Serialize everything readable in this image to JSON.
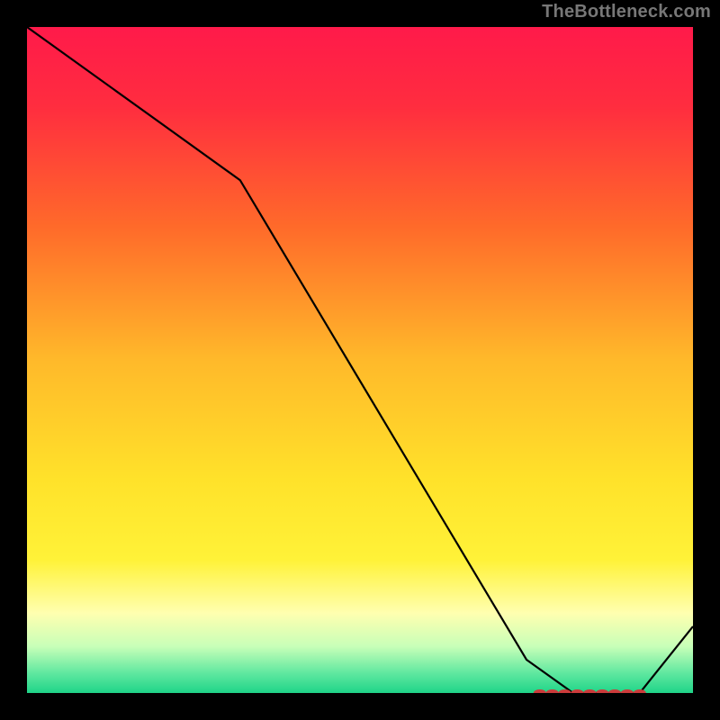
{
  "attribution": "TheBottleneck.com",
  "chart_data": {
    "type": "line",
    "title": "",
    "xlabel": "",
    "ylabel": "",
    "xlim": [
      0,
      100
    ],
    "ylim": [
      0,
      100
    ],
    "x": [
      0,
      32,
      75,
      82,
      84,
      87,
      90,
      92,
      100
    ],
    "values": [
      100,
      77,
      5,
      0,
      0,
      0,
      0,
      0,
      10
    ],
    "flat_region_x": [
      77,
      92
    ],
    "background_gradient": {
      "stops": [
        {
          "offset": 0.0,
          "color": "#ff1a4a"
        },
        {
          "offset": 0.12,
          "color": "#ff2d3f"
        },
        {
          "offset": 0.3,
          "color": "#ff6a2a"
        },
        {
          "offset": 0.5,
          "color": "#ffb92a"
        },
        {
          "offset": 0.68,
          "color": "#ffe22a"
        },
        {
          "offset": 0.8,
          "color": "#fff238"
        },
        {
          "offset": 0.88,
          "color": "#ffffb0"
        },
        {
          "offset": 0.93,
          "color": "#c8ffb8"
        },
        {
          "offset": 0.97,
          "color": "#60e8a0"
        },
        {
          "offset": 1.0,
          "color": "#1fd488"
        }
      ]
    },
    "marker_color": "#cc3b3b",
    "line_color": "#000000"
  }
}
